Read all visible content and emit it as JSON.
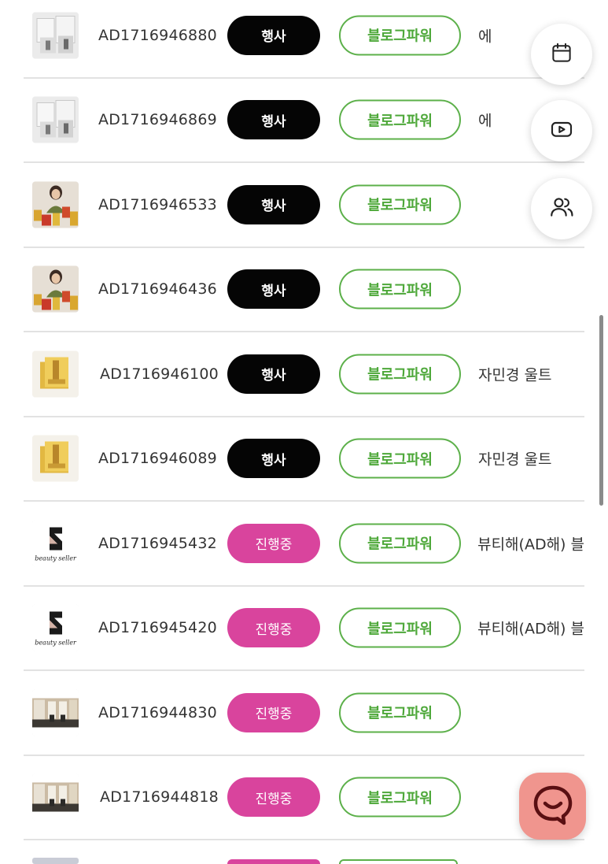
{
  "rows": [
    {
      "id": "AD1716946880",
      "status": "행사",
      "status_type": "event",
      "media": "블로그파워",
      "title": "에",
      "thumb": "product-box-icon"
    },
    {
      "id": "AD1716946869",
      "status": "행사",
      "status_type": "event",
      "media": "블로그파워",
      "title": "에",
      "thumb": "product-box-icon"
    },
    {
      "id": "AD1716946533",
      "status": "행사",
      "status_type": "event",
      "media": "블로그파워",
      "title": "",
      "thumb": "woman-gifts-photo"
    },
    {
      "id": "AD1716946436",
      "status": "행사",
      "status_type": "event",
      "media": "블로그파워",
      "title": "",
      "thumb": "woman-gifts-photo"
    },
    {
      "id": "AD1716946100",
      "status": "행사",
      "status_type": "event",
      "media": "블로그파워",
      "title": "자민경 울트",
      "thumb": "gold-box-photo"
    },
    {
      "id": "AD1716946089",
      "status": "행사",
      "status_type": "event",
      "media": "블로그파워",
      "title": "자민경 울트",
      "thumb": "gold-box-photo"
    },
    {
      "id": "AD1716945432",
      "status": "진행중",
      "status_type": "progress",
      "media": "블로그파워",
      "title": "뷰티해(AD해) 블",
      "thumb": "beauty-seller-logo",
      "thumb_text": "beauty seller"
    },
    {
      "id": "AD1716945420",
      "status": "진행중",
      "status_type": "progress",
      "media": "블로그파워",
      "title": "뷰티해(AD해) 블",
      "thumb": "beauty-seller-logo",
      "thumb_text": "beauty seller"
    },
    {
      "id": "AD1716944830",
      "status": "진행중",
      "status_type": "progress",
      "media": "블로그파워",
      "title": "",
      "thumb": "salon-interior-photo"
    },
    {
      "id": "AD1716944818",
      "status": "진행중",
      "status_type": "progress",
      "media": "블로그파워",
      "title": "",
      "thumb": "salon-interior-photo"
    }
  ],
  "floating": {
    "calendar_icon": "calendar-icon",
    "video_icon": "play-video-icon",
    "users_icon": "users-icon",
    "chat_icon": "chat-smile-icon"
  },
  "colors": {
    "event_badge": "#050505",
    "progress_badge": "#d9449d",
    "media_accent": "#4ea83a",
    "chat_fab": "#f0958e"
  }
}
